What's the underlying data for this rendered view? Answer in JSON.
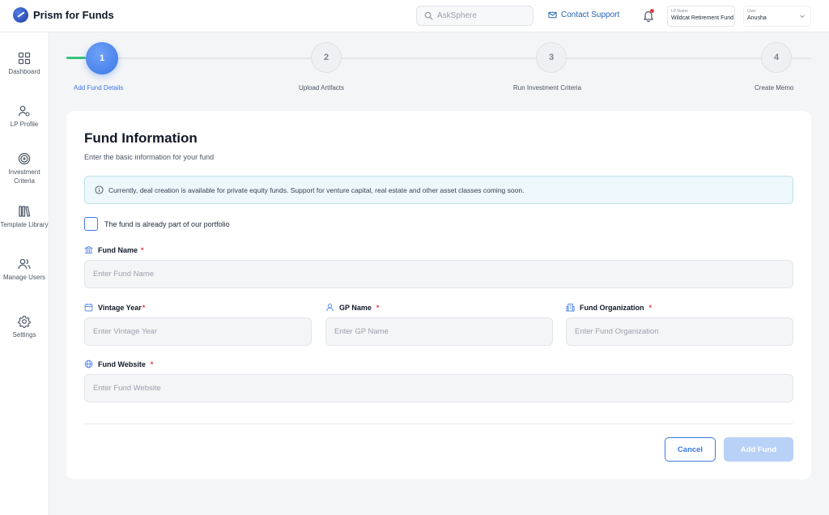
{
  "app": {
    "title": "Prism for Funds"
  },
  "header": {
    "search_placeholder": "AskSphere",
    "contact_label": "Contact Support",
    "lp_select": {
      "label": "LP Name",
      "value": "Wildcat Retirement Fund"
    },
    "user_select": {
      "label": "User",
      "value": "Anusha"
    }
  },
  "sidebar": {
    "items": [
      {
        "label": "Dashboard",
        "icon": "grid-icon"
      },
      {
        "label": "LP Profile",
        "icon": "user-gear-icon"
      },
      {
        "label": "Investment Criteria",
        "icon": "target-icon"
      },
      {
        "label": "Template Library",
        "icon": "books-icon"
      },
      {
        "label": "Manage Users",
        "icon": "users-icon"
      },
      {
        "label": "Settings",
        "icon": "gear-icon"
      }
    ]
  },
  "stepper": {
    "current": 1,
    "steps": [
      {
        "num": "1",
        "label": "Add Fund Details"
      },
      {
        "num": "2",
        "label": "Upload Artifacts"
      },
      {
        "num": "3",
        "label": "Run Investment Criteria"
      },
      {
        "num": "4",
        "label": "Create Memo"
      }
    ]
  },
  "form": {
    "title": "Fund Information",
    "subtitle": "Enter the basic information for your fund",
    "notice": "Currently, deal creation is available for  private equity funds. Support for venture capital, real estate and other asset classes coming soon.",
    "portfolio_checkbox_label": "The fund is already part of our portfolio",
    "portfolio_checked": false,
    "required_mark": "*",
    "fields": {
      "fund_name": {
        "label": "Fund Name",
        "placeholder": "Enter Fund Name",
        "value": ""
      },
      "vintage_year": {
        "label": "Vintage Year",
        "placeholder": "Enter Vintage Year",
        "value": ""
      },
      "gp_name": {
        "label": "GP Name",
        "placeholder": "Enter GP Name",
        "value": ""
      },
      "fund_org": {
        "label": "Fund Organization",
        "placeholder": "Enter Fund Organization",
        "value": ""
      },
      "fund_website": {
        "label": "Fund Website",
        "placeholder": "Enter Fund Website",
        "value": ""
      }
    },
    "cancel_label": "Cancel",
    "submit_label": "Add Fund"
  },
  "colors": {
    "accent": "#3b78e6",
    "success": "#34c27a",
    "required": "#e23b3b",
    "disabled_button": "#b8d1f7"
  }
}
